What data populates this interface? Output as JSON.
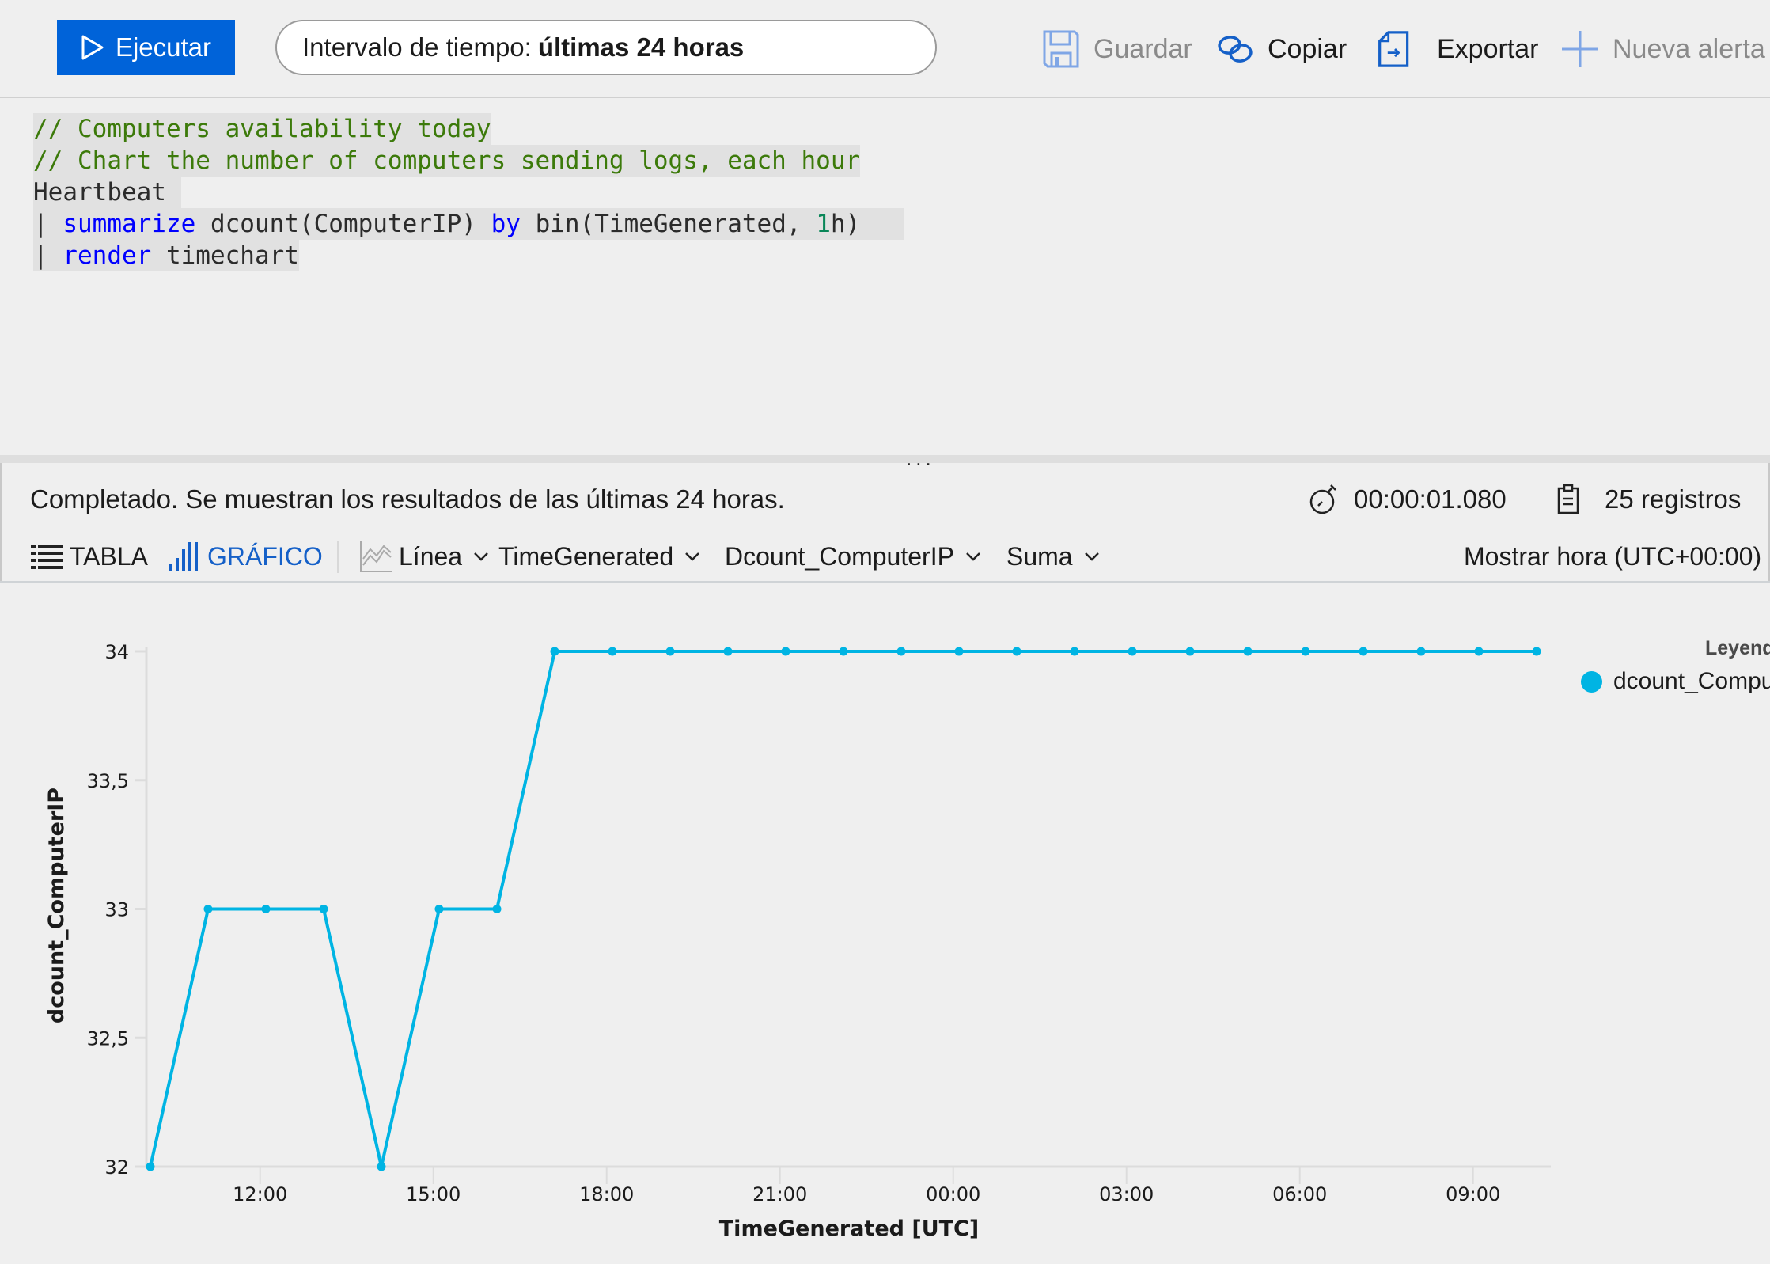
{
  "toolbar": {
    "run_label": "Ejecutar",
    "time_range_label": "Intervalo de tiempo:",
    "time_range_value": "últimas 24 horas",
    "save_label": "Guardar",
    "copy_label": "Copiar",
    "export_label": "Exportar",
    "new_alert_label": "Nueva alerta"
  },
  "editor": {
    "lines": [
      {
        "tokens": [
          {
            "t": "cmt",
            "v": "// Computers availability today"
          }
        ]
      },
      {
        "tokens": [
          {
            "t": "cmt",
            "v": "// Chart the number of computers sending logs, each hour"
          }
        ]
      },
      {
        "tokens": [
          {
            "t": "plain",
            "v": "Heartbeat "
          }
        ]
      },
      {
        "tokens": [
          {
            "t": "plain",
            "v": "| "
          },
          {
            "t": "kw",
            "v": "summarize"
          },
          {
            "t": "plain",
            "v": " dcount(ComputerIP) "
          },
          {
            "t": "kw",
            "v": "by"
          },
          {
            "t": "plain",
            "v": " bin(TimeGenerated, "
          },
          {
            "t": "num",
            "v": "1"
          },
          {
            "t": "plain",
            "v": "h)   "
          }
        ]
      },
      {
        "tokens": [
          {
            "t": "plain",
            "v": "| "
          },
          {
            "t": "kw",
            "v": "render"
          },
          {
            "t": "plain",
            "v": " timechart"
          }
        ]
      }
    ]
  },
  "splitter": {
    "dots": "..."
  },
  "status": {
    "message": "Completado. Se muestran los resultados de las últimas 24 horas.",
    "duration": "00:00:01.080",
    "records": "25 registros"
  },
  "results_toolbar": {
    "table_label": "TABLA",
    "chart_label": "GRÁFICO",
    "chart_type": "Línea",
    "x_column": "TimeGenerated",
    "y_column": "Dcount_ComputerIP",
    "aggregation": "Suma",
    "timezone_label": "Mostrar hora (UTC+00:00)"
  },
  "colors": {
    "accent": "#0063d9",
    "series": "#00b4e3",
    "active_tab": "#1560c8",
    "comment": "#3c7a0a",
    "keyword": "#0000ff"
  },
  "chart_data": {
    "type": "line",
    "title": "",
    "xlabel": "TimeGenerated [UTC]",
    "ylabel": "dcount_ComputerIP",
    "ylim": [
      32,
      34
    ],
    "yticks": [
      "32",
      "32,5",
      "33",
      "33,5",
      "34"
    ],
    "yticks_values": [
      32,
      32.5,
      33,
      33.5,
      34
    ],
    "xticks": [
      "12:00",
      "15:00",
      "18:00",
      "21:00",
      "00:00",
      "03:00",
      "06:00",
      "09:00"
    ],
    "xticks_hours_from_start": [
      1.9,
      4.9,
      7.9,
      10.9,
      13.9,
      16.9,
      19.9,
      22.9
    ],
    "x_start": "~10:06 UTC",
    "x_step": "1h",
    "legend": {
      "title": "Leyenda",
      "placement": "right",
      "entries": [
        "dcount_ComputerIP"
      ]
    },
    "grid": false,
    "series": [
      {
        "name": "dcount_ComputerIP",
        "values": [
          32,
          33,
          33,
          33,
          32,
          33,
          33,
          34,
          34,
          34,
          34,
          34,
          34,
          34,
          34,
          34,
          34,
          34,
          34,
          34,
          34,
          34,
          34,
          34,
          34
        ]
      }
    ]
  },
  "legend": {
    "title": "Leyenda",
    "item": "dcount_ComputerIP"
  }
}
